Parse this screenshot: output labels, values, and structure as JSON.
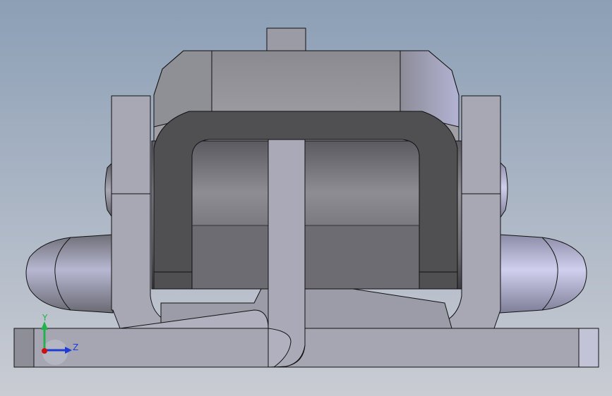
{
  "viewport": {
    "background_top": "#8c9fb6",
    "background_bottom": "#c7cbd2",
    "model_color": "#a6a6b2",
    "edge_color": "#111111"
  },
  "triad": {
    "y_label": "Y",
    "z_label": "Z",
    "y_color": "#22b14c",
    "z_color": "#1f3bd6",
    "x_color": "#d01010"
  }
}
